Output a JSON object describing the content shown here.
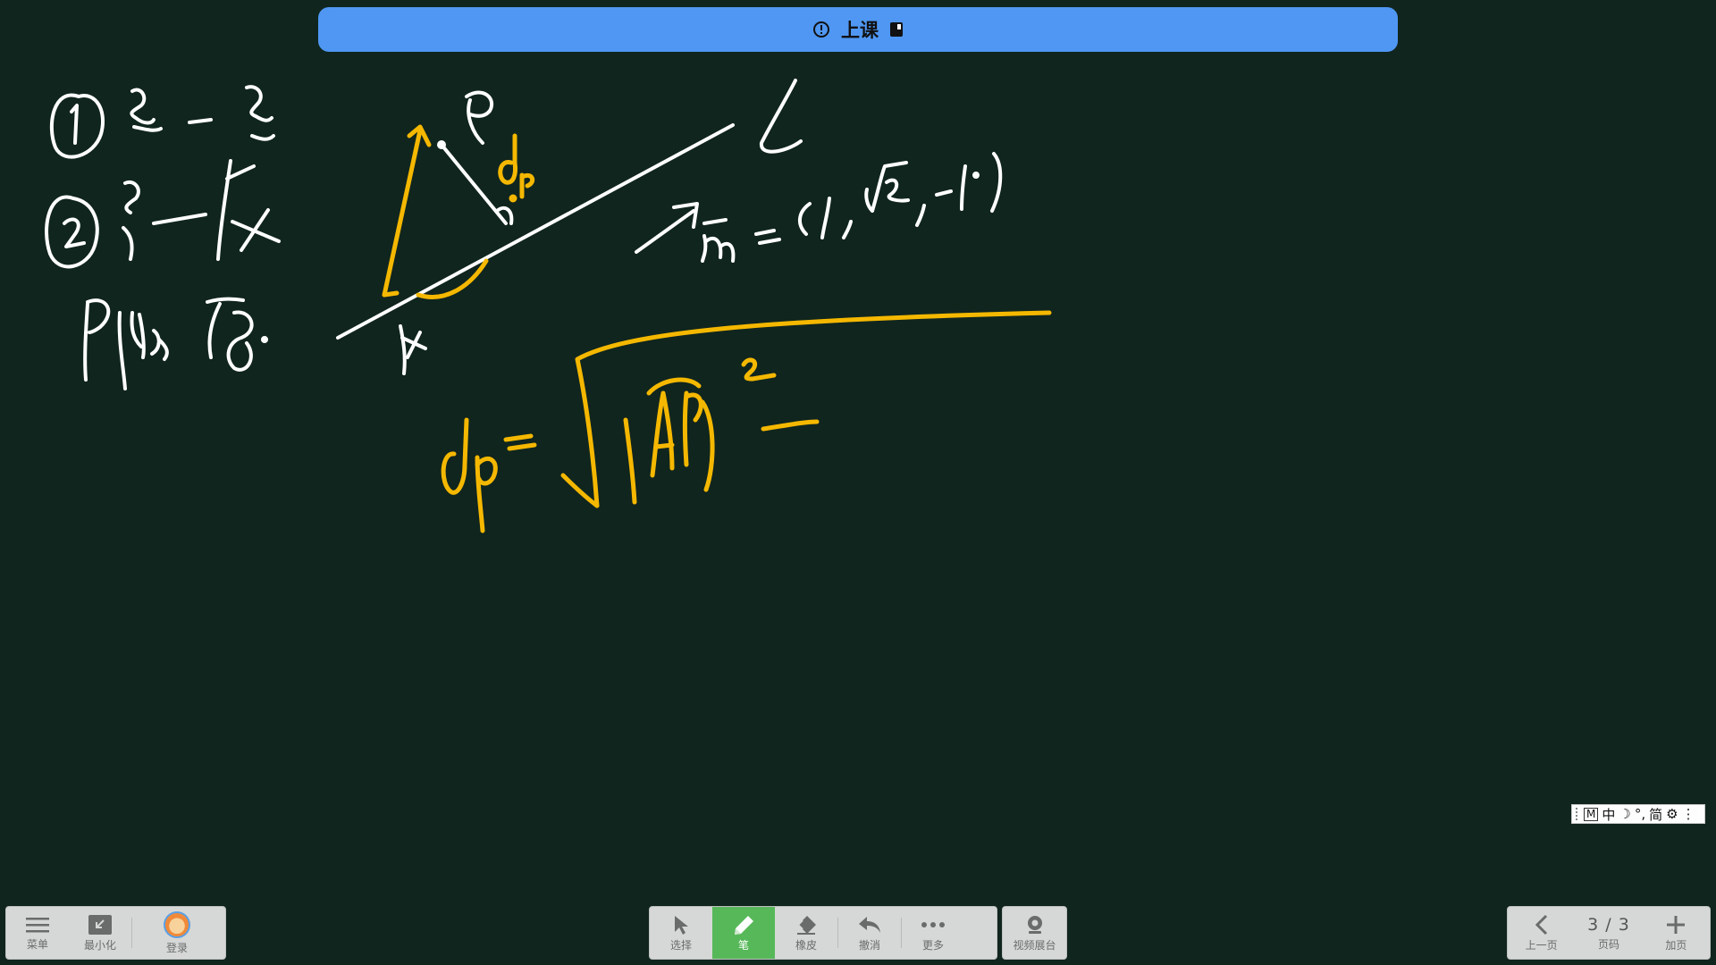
{
  "top_bar": {
    "title": "上课"
  },
  "ime": {
    "m": "M",
    "lang": "中",
    "moon": "☽",
    "punct": "°,",
    "script": "简",
    "gear": "⚙",
    "more": "⋮"
  },
  "left_toolbar": {
    "menu_label": "菜单",
    "minimize_label": "最小化",
    "login_label": "登录"
  },
  "tools": {
    "select_label": "选择",
    "pen_label": "笔",
    "eraser_label": "橡皮",
    "undo_label": "撤消",
    "more_label": "更多",
    "camera_label": "视频展台"
  },
  "pager": {
    "prev_label": "上一页",
    "page_value": "3 / 3",
    "page_label": "页码",
    "add_label": "加页"
  },
  "colors": {
    "board": "#10251e",
    "ink_white": "#ffffff",
    "ink_yellow": "#f5b800",
    "accent": "#4f97f2",
    "active_tool": "#57b85a"
  }
}
